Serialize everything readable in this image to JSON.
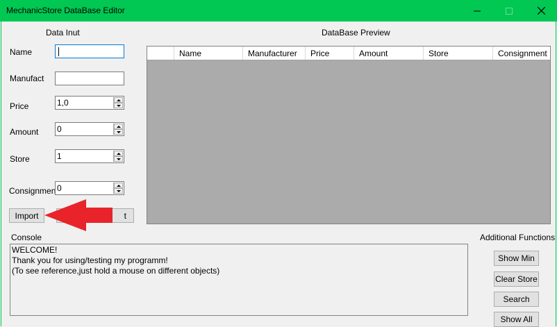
{
  "window": {
    "title": "MechanicStore DataBase Editor",
    "accent_color": "#00c853"
  },
  "input_panel": {
    "heading": "Data Inut",
    "name_label": "Name",
    "name_value": "",
    "manufacturer_label": "Manufact",
    "manufacturer_value": "",
    "price_label": "Price",
    "price_value": "1,0",
    "amount_label": "Amount",
    "amount_value": "0",
    "store_label": "Store",
    "store_value": "1",
    "consignment_label": "Consignment",
    "consignment_value": "0",
    "import_label": "Import",
    "hidden_button_tail": "t"
  },
  "preview": {
    "heading": "DataBase Preview",
    "columns": [
      "Name",
      "Manufacturer",
      "Price",
      "Amount",
      "Store",
      "Consignment"
    ]
  },
  "console": {
    "heading": "Console",
    "lines": [
      "WELCOME!",
      "Thank you for using/testing my programm!",
      "(To see reference,just hold a mouse on different objects)"
    ]
  },
  "functions": {
    "heading": "Additional Functions",
    "buttons": [
      "Show Min",
      "Clear Store",
      "Search",
      "Show All"
    ]
  },
  "annotation": {
    "arrow_color": "#e8242a",
    "arrow_icon": "red-arrow-pointing-left"
  }
}
